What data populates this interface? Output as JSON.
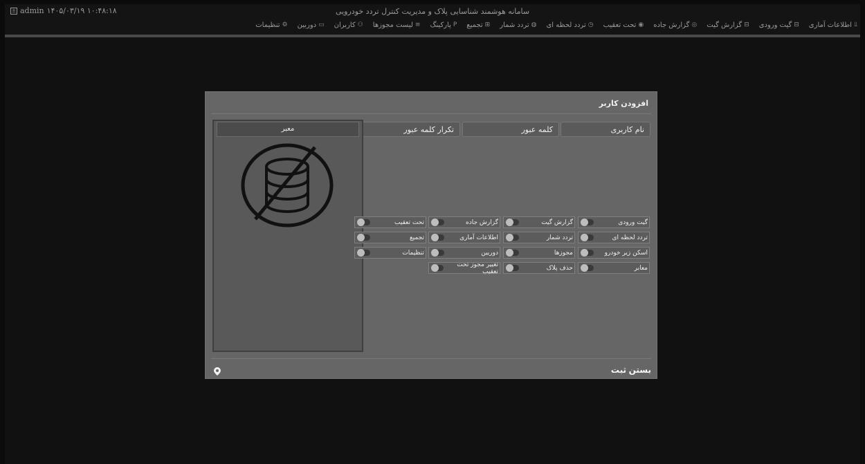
{
  "app": {
    "title": "سامانه هوشمند شناسایی پلاک و مدیریت کنترل تردد خودرویی",
    "user": "admin",
    "datetime": "۱۴۰۵/۰۳/۱۹ ۱۰:۴۸:۱۸",
    "user_icon": "user-box-icon"
  },
  "menu": [
    {
      "label": "اطلاعات آماری",
      "icon": "chart-icon",
      "glyph": "⫫"
    },
    {
      "label": "گیت ورودی",
      "icon": "gate-icon",
      "glyph": "⊟"
    },
    {
      "label": "گزارش گیت",
      "icon": "report-icon",
      "glyph": "⊟"
    },
    {
      "label": "گزارش جاده",
      "icon": "road-icon",
      "glyph": "◎"
    },
    {
      "label": "تحت تعقیب",
      "icon": "target-icon",
      "glyph": "◉"
    },
    {
      "label": "تردد لحظه ای",
      "icon": "clock-icon",
      "glyph": "◷"
    },
    {
      "label": "تردد شمار",
      "icon": "counter-icon",
      "glyph": "◍"
    },
    {
      "label": "تجمیع",
      "icon": "aggregate-icon",
      "glyph": "⊞"
    },
    {
      "label": "پارکینگ",
      "icon": "parking-icon",
      "glyph": "P"
    },
    {
      "label": "لیست مجوزها",
      "icon": "list-icon",
      "glyph": "≡"
    },
    {
      "label": "کاربران",
      "icon": "users-icon",
      "glyph": "⚇"
    },
    {
      "label": "دوربین",
      "icon": "camera-icon",
      "glyph": "▭"
    },
    {
      "label": "تنظیمات",
      "icon": "gear-icon",
      "glyph": "⚙"
    }
  ],
  "modal": {
    "title": "افزودن کاربر",
    "fields": {
      "username": "نام کاربری",
      "password": "کلمه عبور",
      "password_repeat": "تکرار کلمه عبور"
    },
    "panel_title": "معبر",
    "panel_icon": "no-database-icon",
    "permissions": [
      [
        "گیت ورودی",
        "گزارش گیت",
        "گزارش جاده",
        "تحت تعقیب"
      ],
      [
        "تردد لحظه ای",
        "تردد شمار",
        "اطلاعات آماری",
        "تجمیع"
      ],
      [
        "اسکن زیر خودرو",
        "مجوزها",
        "دوربین",
        "تنظیمات"
      ],
      [
        "معابر",
        "حذف پلاک",
        "تغییر مجوز تحت تعقیب"
      ]
    ],
    "close_label": "بستن",
    "submit_label": "ثبت",
    "location_icon": "location-pin-icon"
  }
}
